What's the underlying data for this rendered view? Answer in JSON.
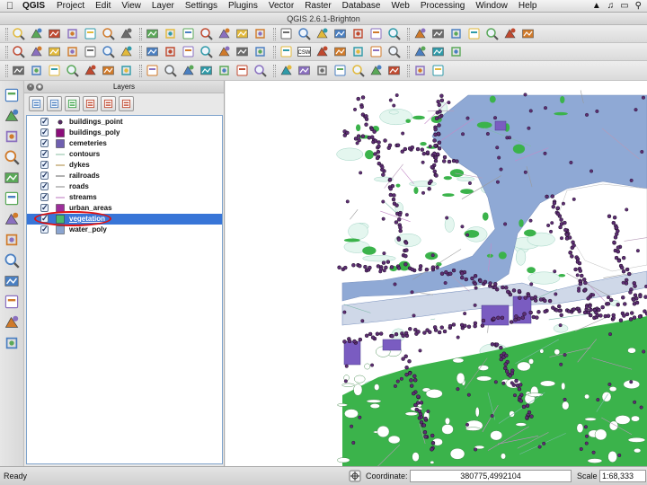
{
  "menubar": {
    "app_name": "QGIS",
    "items": [
      "Project",
      "Edit",
      "View",
      "Layer",
      "Settings",
      "Plugins",
      "Vector",
      "Raster",
      "Database",
      "Web",
      "Processing",
      "Window",
      "Help"
    ]
  },
  "window": {
    "title": "QGIS 2.6.1-Brighton"
  },
  "toolbars": {
    "row1": [
      "new-project",
      "open-project",
      "save-project",
      "save-as",
      "new-print-composer",
      "composer-manager",
      "pan",
      "pan-to-selection",
      "zoom-in",
      "zoom-out",
      "zoom-full",
      "zoom-to-selection",
      "zoom-to-layer",
      "zoom-native",
      "zoom-last",
      "zoom-next",
      "refresh",
      "identify",
      "select-features",
      "deselect",
      "measure",
      "field-calculator",
      "attribute-table",
      "statistics",
      "map-tips",
      "new-bookmark",
      "show-bookmarks",
      "text-annotation"
    ],
    "row2": [
      "current-edits",
      "toggle-editing",
      "save-edits",
      "add-feature",
      "move-feature",
      "delete-selected",
      "cut-features",
      "copy-features",
      "paste-features",
      "label-tool",
      "pin-labels",
      "show-hide-labels",
      "move-label",
      "rotate-label",
      "change-label",
      "csw-search",
      "add-vector",
      "add-raster",
      "add-postgis",
      "add-spatialite",
      "add-wms",
      "add-wcs",
      "add-wfs",
      "new-shapefile"
    ],
    "row3": [
      "undo",
      "redo",
      "simplify",
      "add-ring",
      "add-part",
      "fill-ring",
      "delete-ring",
      "delete-part",
      "reshape",
      "offset-curve",
      "split-features",
      "split-parts",
      "merge-selected",
      "merge-attributes",
      "rotate-point",
      "node-tool",
      "gps",
      "plugin-a",
      "plugin-b",
      "plugin-c",
      "plugin-d",
      "plugin-e",
      "plugin-f"
    ],
    "csw_label": "CSW"
  },
  "left_toolbar": [
    "add-vector-layer",
    "add-raster-layer",
    "add-postgis-layer",
    "add-spatialite-layer",
    "add-mssql-layer",
    "add-wms-layer",
    "add-wcs-layer",
    "add-wfs-layer",
    "add-delimited-text",
    "new-shapefile-layer",
    "add-csv",
    "gps-tool",
    "python-console"
  ],
  "layers_panel": {
    "title": "Layers",
    "tools": [
      "open-layer-styling",
      "add-group",
      "filter-legend",
      "expand-all",
      "collapse-all",
      "remove-layer"
    ],
    "layers": [
      {
        "name": "buildings_point",
        "checked": true,
        "symbol": "point",
        "color": "#5a2a6a"
      },
      {
        "name": "buildings_poly",
        "checked": true,
        "symbol": "fill",
        "color": "#8b0d7a"
      },
      {
        "name": "cemeteries",
        "checked": true,
        "symbol": "fill",
        "color": "#6f5fb0"
      },
      {
        "name": "contours",
        "checked": true,
        "symbol": "line",
        "color": "#9cc8b0"
      },
      {
        "name": "dykes",
        "checked": true,
        "symbol": "line",
        "color": "#b89a5a"
      },
      {
        "name": "railroads",
        "checked": true,
        "symbol": "line",
        "color": "#7d7d7d"
      },
      {
        "name": "roads",
        "checked": true,
        "symbol": "line",
        "color": "#9a9a9a"
      },
      {
        "name": "streams",
        "checked": true,
        "symbol": "line",
        "color": "#c68ac8"
      },
      {
        "name": "urban_areas",
        "checked": true,
        "symbol": "fill",
        "color": "#9d2e9a"
      },
      {
        "name": "vegetation",
        "checked": true,
        "symbol": "fill",
        "color": "#4cba6a",
        "selected": true
      },
      {
        "name": "water_poly",
        "checked": true,
        "symbol": "fill",
        "color": "#8aa4d0"
      }
    ]
  },
  "map": {
    "colors": {
      "water": "#8fa9d5",
      "vegetation": "#3bb34b",
      "buildings": "#5d2e73",
      "cemeteries": "#7a5cc1",
      "contours": "#c7e8df",
      "roads": "#9a8a9a"
    }
  },
  "status": {
    "ready": "Ready",
    "coordinate_label": "Coordinate:",
    "coordinate_value": "380775,4992104",
    "scale_label": "Scale",
    "scale_value": "1:68,333"
  },
  "menubar_right": [
    "wifi-icon",
    "volume-icon",
    "battery-icon",
    "spotlight-icon"
  ]
}
